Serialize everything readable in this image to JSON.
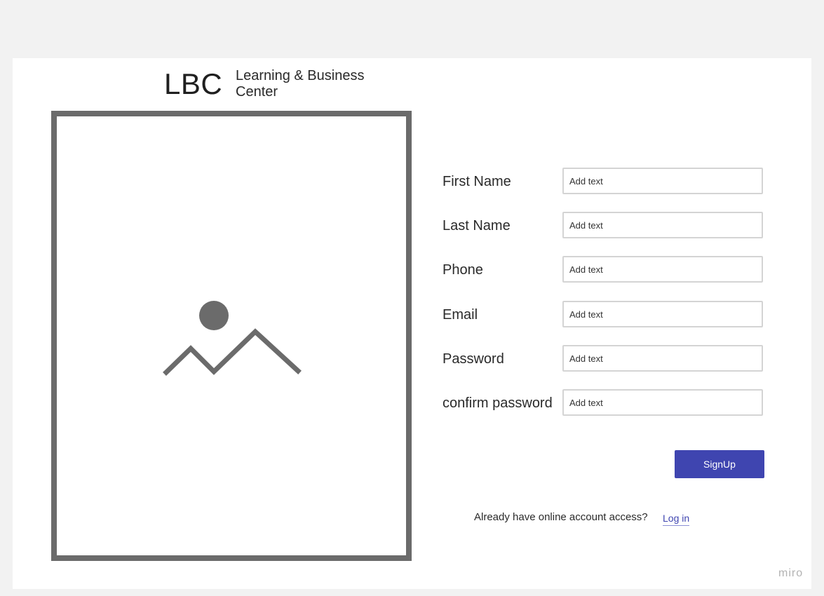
{
  "brand": {
    "logo_text": "LBC",
    "name": "Learning & Business Center"
  },
  "form": {
    "fields": [
      {
        "label": "First Name",
        "placeholder": "Add text"
      },
      {
        "label": "Last Name",
        "placeholder": "Add text"
      },
      {
        "label": "Phone",
        "placeholder": "Add text"
      },
      {
        "label": "Email",
        "placeholder": "Add text"
      },
      {
        "label": "Password",
        "placeholder": "Add text"
      },
      {
        "label": "confirm password",
        "placeholder": "Add text"
      }
    ],
    "submit_label": "SignUp"
  },
  "login": {
    "prompt": "Already have online account access?",
    "link_label": "Log in"
  },
  "watermark": "miro",
  "colors": {
    "accent": "#3f45b0",
    "placeholder_frame": "#6b6b6b",
    "canvas": "#f2f2f2"
  },
  "icons": {
    "image_placeholder": "image-icon"
  }
}
